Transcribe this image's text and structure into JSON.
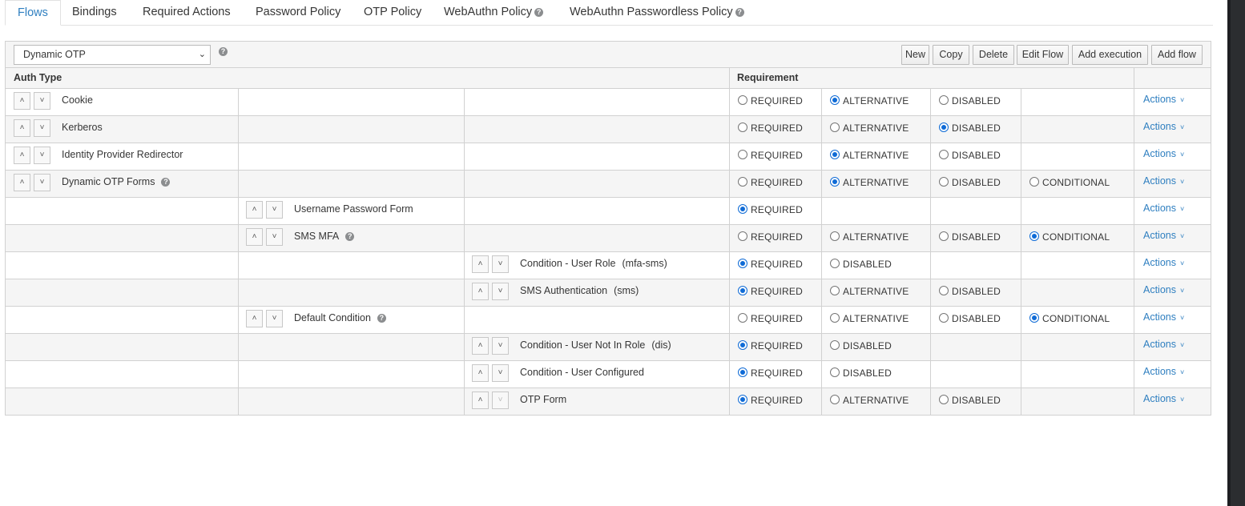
{
  "tabs": [
    {
      "label": "Flows",
      "active": true
    },
    {
      "label": "Bindings"
    },
    {
      "label": "Required Actions"
    },
    {
      "label": "Password Policy"
    },
    {
      "label": "OTP Policy"
    },
    {
      "label": "WebAuthn Policy",
      "help": true
    },
    {
      "label": "WebAuthn Passwordless Policy",
      "help": true
    }
  ],
  "toolbar": {
    "selected_flow": "Dynamic OTP",
    "buttons": [
      "New",
      "Copy",
      "Delete",
      "Edit Flow",
      "Add execution",
      "Add flow"
    ]
  },
  "table": {
    "headers": {
      "auth_type": "Auth Type",
      "requirement": "Requirement"
    },
    "actions_label": "Actions",
    "rows": [
      {
        "level": 0,
        "name": "Cookie",
        "alias": "",
        "help": false,
        "options": [
          {
            "label": "REQUIRED",
            "checked": false
          },
          {
            "label": "ALTERNATIVE",
            "checked": true
          },
          {
            "label": "DISABLED",
            "checked": false
          }
        ]
      },
      {
        "level": 0,
        "name": "Kerberos",
        "alias": "",
        "help": false,
        "options": [
          {
            "label": "REQUIRED",
            "checked": false
          },
          {
            "label": "ALTERNATIVE",
            "checked": false
          },
          {
            "label": "DISABLED",
            "checked": true
          }
        ]
      },
      {
        "level": 0,
        "name": "Identity Provider Redirector",
        "alias": "",
        "help": false,
        "options": [
          {
            "label": "REQUIRED",
            "checked": false
          },
          {
            "label": "ALTERNATIVE",
            "checked": true
          },
          {
            "label": "DISABLED",
            "checked": false
          }
        ]
      },
      {
        "level": 0,
        "name": "Dynamic OTP Forms",
        "alias": "",
        "help": true,
        "options": [
          {
            "label": "REQUIRED",
            "checked": false
          },
          {
            "label": "ALTERNATIVE",
            "checked": true
          },
          {
            "label": "DISABLED",
            "checked": false
          },
          {
            "label": "CONDITIONAL",
            "checked": false
          }
        ]
      },
      {
        "level": 1,
        "name": "Username Password Form",
        "alias": "",
        "help": false,
        "options": [
          {
            "label": "REQUIRED",
            "checked": true
          }
        ]
      },
      {
        "level": 1,
        "name": "SMS MFA",
        "alias": "",
        "help": true,
        "options": [
          {
            "label": "REQUIRED",
            "checked": false
          },
          {
            "label": "ALTERNATIVE",
            "checked": false
          },
          {
            "label": "DISABLED",
            "checked": false
          },
          {
            "label": "CONDITIONAL",
            "checked": true
          }
        ]
      },
      {
        "level": 2,
        "name": "Condition - User Role",
        "alias": "(mfa-sms)",
        "help": false,
        "options": [
          {
            "label": "REQUIRED",
            "checked": true
          },
          {
            "label": "DISABLED",
            "checked": false
          }
        ]
      },
      {
        "level": 2,
        "name": "SMS Authentication",
        "alias": "(sms)",
        "help": false,
        "options": [
          {
            "label": "REQUIRED",
            "checked": true
          },
          {
            "label": "ALTERNATIVE",
            "checked": false
          },
          {
            "label": "DISABLED",
            "checked": false
          }
        ]
      },
      {
        "level": 1,
        "name": "Default Condition",
        "alias": "",
        "help": true,
        "options": [
          {
            "label": "REQUIRED",
            "checked": false
          },
          {
            "label": "ALTERNATIVE",
            "checked": false
          },
          {
            "label": "DISABLED",
            "checked": false
          },
          {
            "label": "CONDITIONAL",
            "checked": true
          }
        ]
      },
      {
        "level": 2,
        "name": "Condition - User Not In Role",
        "alias": "(dis)",
        "help": false,
        "options": [
          {
            "label": "REQUIRED",
            "checked": true
          },
          {
            "label": "DISABLED",
            "checked": false
          }
        ]
      },
      {
        "level": 2,
        "name": "Condition - User Configured",
        "alias": "",
        "help": false,
        "options": [
          {
            "label": "REQUIRED",
            "checked": true
          },
          {
            "label": "DISABLED",
            "checked": false
          }
        ]
      },
      {
        "level": 2,
        "name": "OTP Form",
        "alias": "",
        "help": false,
        "down_disabled": true,
        "options": [
          {
            "label": "REQUIRED",
            "checked": true
          },
          {
            "label": "ALTERNATIVE",
            "checked": false
          },
          {
            "label": "DISABLED",
            "checked": false
          }
        ]
      }
    ]
  },
  "icons": {
    "move_up": "chevron-up-icon",
    "move_down": "chevron-down-icon",
    "help": "question-circle-icon",
    "actions_caret": "chevron-down-icon"
  },
  "colors": {
    "accent": "#2f7fc0",
    "radio_checked": "#0f6bd6",
    "row_stripe": "#f5f5f5",
    "border": "#d1d1d1"
  }
}
